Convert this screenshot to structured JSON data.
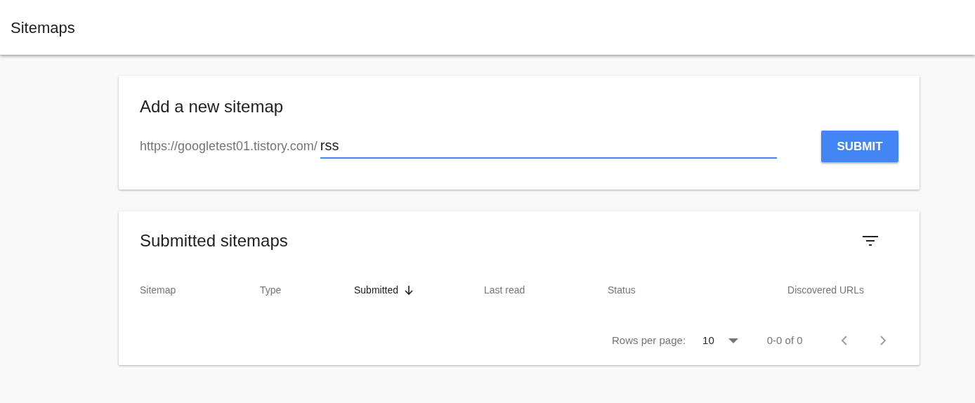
{
  "header": {
    "title": "Sitemaps"
  },
  "add_sitemap": {
    "title": "Add a new sitemap",
    "url_prefix": "https://googletest01.tistory.com/",
    "input_value": "rss",
    "button": "SUBMIT"
  },
  "submitted_sitemaps": {
    "title": "Submitted sitemaps",
    "columns": [
      {
        "label": "Sitemap",
        "sorted": false
      },
      {
        "label": "Type",
        "sorted": false
      },
      {
        "label": "Submitted",
        "sorted": true
      },
      {
        "label": "Last read",
        "sorted": false
      },
      {
        "label": "Status",
        "sorted": false
      },
      {
        "label": "Discovered URLs",
        "sorted": false
      }
    ],
    "pagination": {
      "rows_per_page_label": "Rows per page:",
      "rows_per_page_value": "10",
      "range": "0-0 of 0"
    }
  }
}
